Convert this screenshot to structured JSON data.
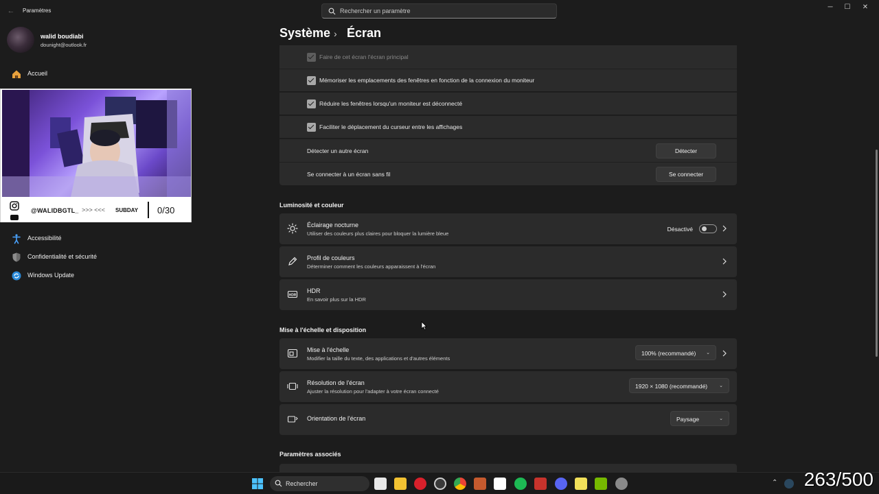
{
  "window": {
    "app_title": "Paramètres",
    "back_icon": "back-arrow-icon",
    "search_placeholder": "Rechercher un paramètre",
    "controls": {
      "minimize": "─",
      "maximize": "☐",
      "close": "✕"
    }
  },
  "profile": {
    "name": "walid boudiabi",
    "email": "dounight@outlook.fr"
  },
  "sidebar": {
    "items": [
      {
        "label": "Accueil",
        "icon": "home-icon"
      },
      {
        "label": "Accessibilité",
        "icon": "accessibility-icon"
      },
      {
        "label": "Confidentialité et sécurité",
        "icon": "shield-icon"
      },
      {
        "label": "Windows Update",
        "icon": "update-icon"
      }
    ]
  },
  "webcam": {
    "handle": "@WALIDBGTL_",
    "arrows": ">>> <<<",
    "event": "SUBDAY",
    "count": "0/30"
  },
  "header": {
    "section": "Système",
    "separator": "›",
    "page": "Écran"
  },
  "multi_display": {
    "rows": [
      {
        "label": "Faire de cet écran l'écran principal",
        "checked": true,
        "disabled": true
      },
      {
        "label": "Mémoriser les emplacements des fenêtres en fonction de la connexion du moniteur",
        "checked": true,
        "disabled": false
      },
      {
        "label": "Réduire les fenêtres lorsqu'un moniteur est déconnecté",
        "checked": true,
        "disabled": false
      },
      {
        "label": "Faciliter le déplacement du curseur entre les affichages",
        "checked": true,
        "disabled": false
      }
    ],
    "detect": {
      "label": "Détecter un autre écran",
      "button": "Détecter"
    },
    "wireless": {
      "label": "Se connecter à un écran sans fil",
      "button": "Se connecter"
    }
  },
  "brightness": {
    "title": "Luminosité et couleur",
    "night_light": {
      "title": "Éclairage nocturne",
      "desc": "Utiliser des couleurs plus claires pour bloquer la lumière bleue",
      "state": "Désactivé",
      "on": false
    },
    "color_profile": {
      "title": "Profil de couleurs",
      "desc": "Déterminer comment les couleurs apparaissent à l'écran"
    },
    "hdr": {
      "title": "HDR",
      "desc": "En savoir plus sur la HDR"
    }
  },
  "scale_layout": {
    "title": "Mise à l'échelle et disposition",
    "scale": {
      "title": "Mise à l'échelle",
      "desc": "Modifier la taille du texte, des applications et d'autres éléments",
      "value": "100% (recommandé)"
    },
    "resolution": {
      "title": "Résolution de l'écran",
      "desc": "Ajuster la résolution pour l'adapter à  votre  écran connecté",
      "value": "1920 × 1080 (recommandé)"
    },
    "orientation": {
      "title": "Orientation de l'écran",
      "value": "Paysage"
    }
  },
  "related": {
    "title": "Paramètres associés"
  },
  "taskbar": {
    "search_label": "Rechercher",
    "counter": "263/500"
  }
}
